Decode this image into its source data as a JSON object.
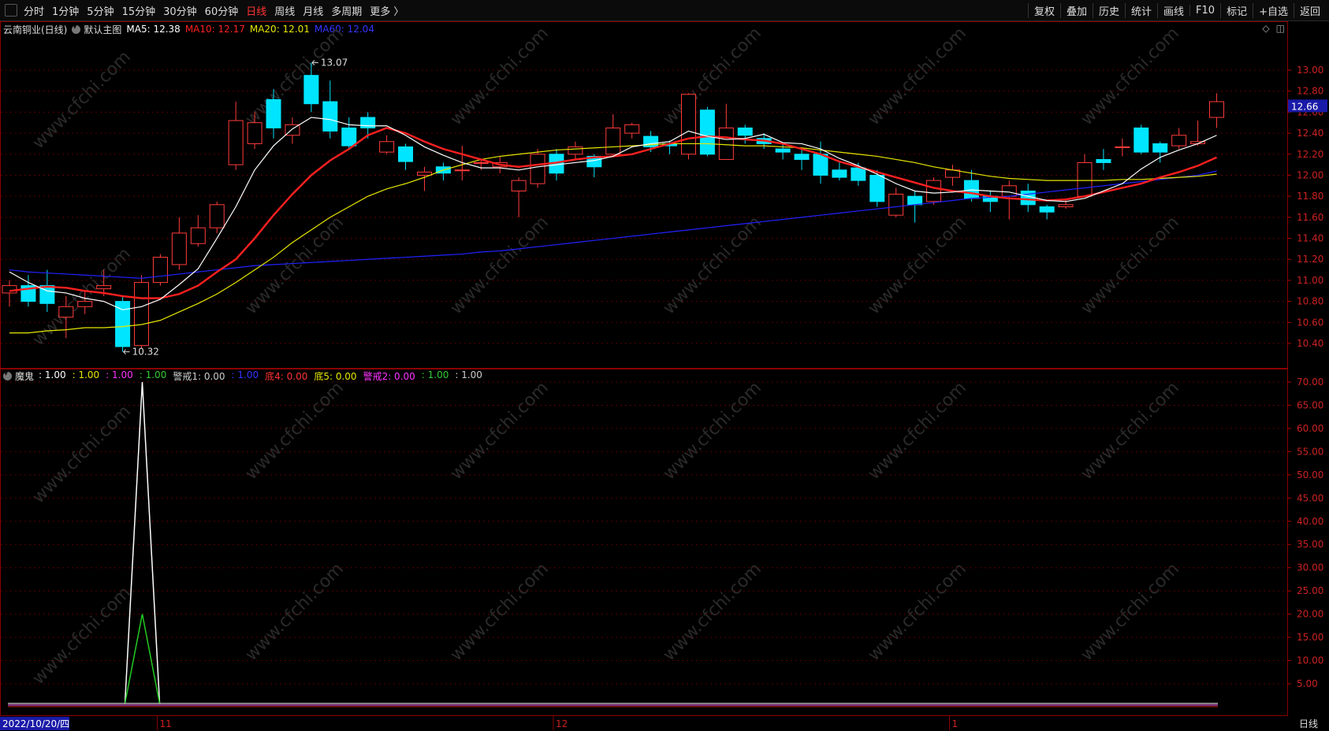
{
  "toolbar": {
    "periods": [
      "分时",
      "1分钟",
      "5分钟",
      "15分钟",
      "30分钟",
      "60分钟",
      "日线",
      "周线",
      "月线",
      "多周期",
      "更多 〉"
    ],
    "active_period": "日线",
    "buttons": [
      "复权",
      "叠加",
      "历史",
      "统计",
      "画线",
      "F10",
      "标记",
      "+自选",
      "返回"
    ]
  },
  "main_legend": {
    "stock": "云南铜业(日线)",
    "template": "默认主图",
    "ma5": "MA5: 12.38",
    "ma10": "MA10: 12.17",
    "ma20": "MA20: 12.01",
    "ma60": "MA60: 12.04",
    "colors": {
      "ma5": "#ffffff",
      "ma10": "#ff2020",
      "ma20": "#e6e600",
      "ma60": "#2222ff"
    }
  },
  "indicator_legend": {
    "name": "魔鬼",
    "items": [
      {
        "text": ": 1.00",
        "color": "#ffffff"
      },
      {
        "text": ": 1.00",
        "color": "#e6e600"
      },
      {
        "text": ": 1.00",
        "color": "#ff33ff"
      },
      {
        "text": ": 1.00",
        "color": "#33cc33"
      },
      {
        "text": "警戒1: 0.00",
        "color": "#cccccc"
      },
      {
        "text": ": 1.00",
        "color": "#3333ff"
      },
      {
        "text": "底4: 0.00",
        "color": "#ff3333"
      },
      {
        "text": "底5: 0.00",
        "color": "#e6e600"
      },
      {
        "text": "警戒2: 0.00",
        "color": "#ff33ff"
      },
      {
        "text": ": 1.00",
        "color": "#33cc33"
      },
      {
        "text": ": 1.00",
        "color": "#cccccc"
      }
    ]
  },
  "price_axis": [
    "13.00",
    "12.80",
    "12.60",
    "12.40",
    "12.20",
    "12.00",
    "11.80",
    "11.60",
    "11.40",
    "11.20",
    "11.00",
    "10.80",
    "10.60",
    "10.40"
  ],
  "current_price": "12.66",
  "indicator_axis": [
    "70.00",
    "65.00",
    "60.00",
    "55.00",
    "50.00",
    "45.00",
    "40.00",
    "35.00",
    "30.00",
    "25.00",
    "20.00",
    "15.00",
    "10.00",
    "5.00"
  ],
  "annotations": {
    "high": "13.07",
    "low": "10.32"
  },
  "date_axis": {
    "first": "2022/10/20/四",
    "months": [
      "11",
      "12",
      "1"
    ]
  },
  "bottom_label": "日线",
  "watermark": "www.cfchi.com",
  "chart_data": {
    "type": "candlestick",
    "ylim": [
      10.2,
      13.15
    ],
    "candles": [
      [
        10.88,
        10.95,
        10.75,
        11.0
      ],
      [
        10.95,
        10.8,
        10.75,
        11.05
      ],
      [
        10.95,
        10.78,
        10.7,
        11.1
      ],
      [
        10.65,
        10.75,
        10.45,
        10.85
      ],
      [
        10.75,
        10.8,
        10.68,
        10.9
      ],
      [
        10.92,
        10.95,
        10.85,
        11.1
      ],
      [
        10.8,
        10.37,
        10.32,
        10.85
      ],
      [
        10.38,
        10.98,
        10.35,
        11.05
      ],
      [
        10.98,
        11.22,
        10.95,
        11.25
      ],
      [
        11.15,
        11.45,
        11.1,
        11.6
      ],
      [
        11.35,
        11.5,
        11.32,
        11.62
      ],
      [
        11.5,
        11.72,
        11.45,
        11.75
      ],
      [
        12.1,
        12.52,
        12.05,
        12.7
      ],
      [
        12.3,
        12.5,
        12.25,
        12.6
      ],
      [
        12.72,
        12.45,
        12.35,
        12.82
      ],
      [
        12.38,
        12.48,
        12.3,
        12.55
      ],
      [
        12.95,
        12.68,
        12.6,
        13.07
      ],
      [
        12.7,
        12.42,
        12.35,
        12.9
      ],
      [
        12.45,
        12.28,
        12.25,
        12.55
      ],
      [
        12.55,
        12.45,
        12.35,
        12.6
      ],
      [
        12.22,
        12.32,
        12.2,
        12.38
      ],
      [
        12.27,
        12.13,
        12.05,
        12.3
      ],
      [
        12.0,
        12.03,
        11.85,
        12.08
      ],
      [
        12.08,
        12.02,
        11.95,
        12.12
      ],
      [
        12.05,
        12.05,
        11.95,
        12.28
      ],
      [
        12.12,
        12.12,
        12.05,
        12.15
      ],
      [
        12.08,
        12.12,
        12.02,
        12.18
      ],
      [
        11.85,
        11.95,
        11.6,
        11.98
      ],
      [
        11.92,
        12.2,
        11.88,
        12.25
      ],
      [
        12.2,
        12.02,
        11.95,
        12.25
      ],
      [
        12.2,
        12.27,
        12.15,
        12.32
      ],
      [
        12.18,
        12.08,
        11.98,
        12.2
      ],
      [
        12.2,
        12.45,
        12.18,
        12.58
      ],
      [
        12.4,
        12.48,
        12.35,
        12.5
      ],
      [
        12.37,
        12.27,
        12.22,
        12.42
      ],
      [
        12.3,
        12.28,
        12.2,
        12.33
      ],
      [
        12.2,
        12.77,
        12.15,
        12.78
      ],
      [
        12.62,
        12.2,
        12.18,
        12.65
      ],
      [
        12.15,
        12.45,
        12.15,
        12.68
      ],
      [
        12.45,
        12.38,
        12.3,
        12.48
      ],
      [
        12.35,
        12.3,
        12.25,
        12.4
      ],
      [
        12.25,
        12.22,
        12.15,
        12.3
      ],
      [
        12.2,
        12.15,
        12.05,
        12.25
      ],
      [
        12.2,
        12.0,
        11.92,
        12.32
      ],
      [
        12.05,
        11.98,
        11.95,
        12.12
      ],
      [
        12.07,
        11.95,
        11.9,
        12.12
      ],
      [
        12.0,
        11.75,
        11.7,
        12.05
      ],
      [
        11.62,
        11.82,
        11.6,
        11.88
      ],
      [
        11.8,
        11.72,
        11.55,
        11.85
      ],
      [
        11.75,
        11.95,
        11.72,
        11.98
      ],
      [
        11.98,
        12.05,
        11.9,
        12.1
      ],
      [
        11.95,
        11.78,
        11.75,
        12.05
      ],
      [
        11.8,
        11.75,
        11.65,
        11.85
      ],
      [
        11.8,
        11.9,
        11.58,
        11.95
      ],
      [
        11.85,
        11.72,
        11.65,
        11.92
      ],
      [
        11.7,
        11.65,
        11.58,
        11.72
      ],
      [
        11.7,
        11.72,
        11.68,
        11.78
      ],
      [
        11.8,
        12.12,
        11.8,
        12.2
      ],
      [
        12.15,
        12.12,
        12.05,
        12.25
      ],
      [
        12.27,
        12.27,
        12.18,
        12.35
      ],
      [
        12.45,
        12.22,
        12.2,
        12.48
      ],
      [
        12.3,
        12.22,
        12.12,
        12.32
      ],
      [
        12.28,
        12.38,
        12.25,
        12.45
      ],
      [
        12.3,
        12.32,
        12.28,
        12.52
      ],
      [
        12.55,
        12.7,
        12.45,
        12.78
      ]
    ],
    "ma5": [
      11.08,
      10.98,
      10.9,
      10.88,
      10.83,
      10.8,
      10.72,
      10.75,
      10.82,
      10.96,
      11.11,
      11.4,
      11.7,
      12.05,
      12.28,
      12.44,
      12.55,
      12.53,
      12.48,
      12.47,
      12.47,
      12.38,
      12.27,
      12.19,
      12.12,
      12.07,
      12.07,
      12.05,
      12.08,
      12.1,
      12.12,
      12.14,
      12.18,
      12.27,
      12.3,
      12.32,
      12.42,
      12.37,
      12.34,
      12.35,
      12.39,
      12.31,
      12.3,
      12.25,
      12.16,
      12.09,
      12.01,
      11.92,
      11.85,
      11.83,
      11.84,
      11.86,
      11.85,
      11.84,
      11.8,
      11.76,
      11.75,
      11.78,
      11.85,
      11.92,
      12.06,
      12.17,
      12.24,
      12.3,
      12.38
    ],
    "ma10": [
      10.9,
      10.92,
      10.94,
      10.93,
      10.9,
      10.88,
      10.85,
      10.83,
      10.83,
      10.87,
      10.95,
      11.08,
      11.2,
      11.4,
      11.62,
      11.82,
      12.0,
      12.14,
      12.25,
      12.38,
      12.45,
      12.4,
      12.32,
      12.25,
      12.2,
      12.15,
      12.1,
      12.08,
      12.1,
      12.12,
      12.15,
      12.17,
      12.18,
      12.2,
      12.25,
      12.3,
      12.35,
      12.37,
      12.36,
      12.34,
      12.33,
      12.3,
      12.25,
      12.2,
      12.13,
      12.08,
      12.03,
      11.98,
      11.93,
      11.88,
      11.85,
      11.83,
      11.8,
      11.78,
      11.77,
      11.76,
      11.77,
      11.8,
      11.84,
      11.88,
      11.92,
      11.98,
      12.03,
      12.09,
      12.17
    ],
    "ma20": [
      10.5,
      10.5,
      10.52,
      10.53,
      10.55,
      10.55,
      10.56,
      10.58,
      10.62,
      10.7,
      10.78,
      10.87,
      10.98,
      11.1,
      11.22,
      11.36,
      11.48,
      11.6,
      11.7,
      11.8,
      11.87,
      11.92,
      11.98,
      12.05,
      12.1,
      12.15,
      12.18,
      12.2,
      12.22,
      12.24,
      12.25,
      12.26,
      12.27,
      12.28,
      12.29,
      12.3,
      12.3,
      12.3,
      12.29,
      12.28,
      12.28,
      12.27,
      12.26,
      12.24,
      12.22,
      12.2,
      12.18,
      12.15,
      12.12,
      12.08,
      12.05,
      12.02,
      11.99,
      11.97,
      11.96,
      11.95,
      11.95,
      11.95,
      11.95,
      11.96,
      11.96,
      11.97,
      11.98,
      11.99,
      12.01
    ],
    "ma60": [
      11.1,
      11.08,
      11.07,
      11.06,
      11.05,
      11.04,
      11.03,
      11.02,
      11.04,
      11.06,
      11.08,
      11.1,
      11.12,
      11.14,
      11.15,
      11.16,
      11.17,
      11.18,
      11.19,
      11.2,
      11.21,
      11.22,
      11.23,
      11.24,
      11.25,
      11.27,
      11.28,
      11.3,
      11.32,
      11.34,
      11.36,
      11.38,
      11.4,
      11.42,
      11.44,
      11.46,
      11.48,
      11.5,
      11.52,
      11.54,
      11.56,
      11.58,
      11.6,
      11.62,
      11.64,
      11.66,
      11.68,
      11.7,
      11.72,
      11.74,
      11.76,
      11.78,
      11.79,
      11.8,
      11.82,
      11.84,
      11.86,
      11.88,
      11.9,
      11.92,
      11.94,
      11.96,
      11.98,
      12.0,
      12.04
    ],
    "indicator": {
      "ylim": [
        0,
        72
      ],
      "white_spike": {
        "index": 7,
        "value": 70
      },
      "green_spike": {
        "index": 7,
        "value": 20
      }
    }
  }
}
